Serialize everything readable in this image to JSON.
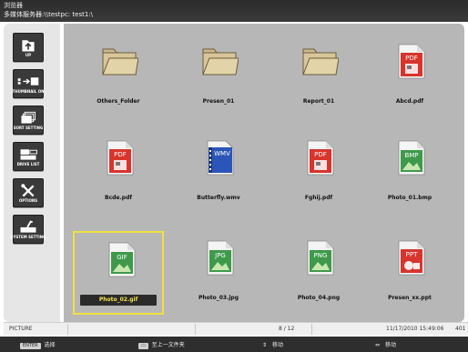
{
  "titlebar": {
    "title": "浏览器",
    "path": "多媒体服务器:\\\\testpc: test1:\\"
  },
  "sidebar": {
    "buttons": [
      {
        "label": "UP",
        "icon": "folder-up-icon"
      },
      {
        "label": "THUMBNAIL ON",
        "icon": "thumbnail-icon"
      },
      {
        "label": "SORT SETTING",
        "icon": "sort-icon"
      },
      {
        "label": "DRIVE LIST",
        "icon": "drive-list-icon"
      },
      {
        "label": "OPTIONS",
        "icon": "tools-icon"
      },
      {
        "label": "SYSTEM SETTING",
        "icon": "system-setting-icon"
      }
    ]
  },
  "files": [
    {
      "name": "Others_Folder",
      "type": "folder"
    },
    {
      "name": "Presen_01",
      "type": "folder"
    },
    {
      "name": "Report_01",
      "type": "folder"
    },
    {
      "name": "Abcd.pdf",
      "type": "pdf",
      "tag": "PDF"
    },
    {
      "name": "Bcde.pdf",
      "type": "pdf",
      "tag": "PDF"
    },
    {
      "name": "Butterfly.wmv",
      "type": "wmv",
      "tag": "WMV"
    },
    {
      "name": "Fghij.pdf",
      "type": "pdf",
      "tag": "PDF"
    },
    {
      "name": "Photo_01.bmp",
      "type": "image",
      "tag": "BMP"
    },
    {
      "name": "Photo_02.gif",
      "type": "image",
      "tag": "GIF",
      "selected": true
    },
    {
      "name": "Photo_03.jpg",
      "type": "image",
      "tag": "JPG"
    },
    {
      "name": "Photo_04.png",
      "type": "image",
      "tag": "PNG"
    },
    {
      "name": "Presen_xx.ppt",
      "type": "ppt",
      "tag": "PPT"
    }
  ],
  "status": {
    "category": "PICTURE",
    "position": "8 / 12",
    "datetime": "11/17/2010  15:49:06",
    "extra": "401"
  },
  "hints": [
    {
      "key": "ENTER",
      "text": "选择"
    },
    {
      "key": "",
      "text": "至上一文件夹"
    },
    {
      "key": "",
      "text": "移动"
    },
    {
      "key": "",
      "text": "移动"
    }
  ],
  "colors": {
    "selection": "#f0e040",
    "pdf_red": "#d8342c",
    "image_green": "#3e9a4a",
    "wmv_blue": "#2b55b8",
    "ppt_red": "#d8342c"
  }
}
